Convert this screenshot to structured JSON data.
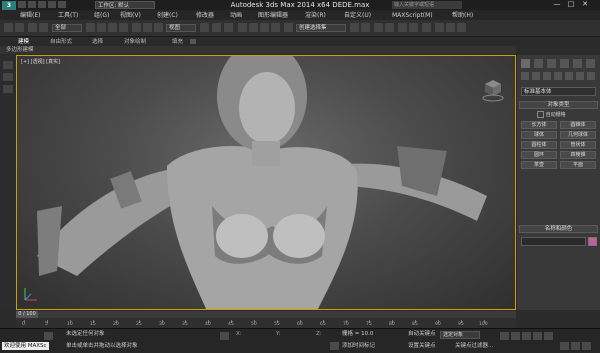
{
  "titlebar": {
    "logo": "3",
    "workspace": "工作区: 默认",
    "title": "Autodesk 3ds Max  2014 x64      DEDE.max",
    "search_placeholder": "输入关键字或短语",
    "window_buttons": [
      "—",
      "□",
      "✕"
    ]
  },
  "menu": [
    "编辑(E)",
    "工具(T)",
    "组(G)",
    "视图(V)",
    "创建(C)",
    "修改器",
    "动画",
    "图形编辑器",
    "渲染(R)",
    "自定义(U)",
    "MAXScript(M)",
    "帮助(H)"
  ],
  "toolbar": {
    "selection_filter": "全部",
    "ref_coord": "视图",
    "named_selection": "创建选择集"
  },
  "ribbon": {
    "tabs": [
      "建模",
      "自由形式",
      "选择",
      "对象绘制",
      "填充"
    ],
    "subtab": "多边形建模"
  },
  "viewport": {
    "label": "[+] [透视] [真实]"
  },
  "command_panel": {
    "category": "标准基本体",
    "rollout_object_type": "对象类型",
    "autogrid": "自动栅格",
    "object_buttons": [
      "长方体",
      "圆锥体",
      "球体",
      "几何球体",
      "圆柱体",
      "管状体",
      "圆环",
      "四棱锥",
      "茶壶",
      "平面"
    ],
    "rollout_name_color": "名称和颜色",
    "swatch_color": "#c060a0"
  },
  "timeline": {
    "current": "0 / 100",
    "ticks": [
      "0",
      "5",
      "10",
      "15",
      "20",
      "25",
      "30",
      "35",
      "40",
      "45",
      "50",
      "55",
      "60",
      "65",
      "70",
      "75",
      "80",
      "85",
      "90",
      "95",
      "100"
    ]
  },
  "status": {
    "maxscript_label": "欢迎使用 MAXSc",
    "prompt_1": "未选定任何对象",
    "prompt_2": "单击或单击并拖动以选择对象",
    "grid": "栅格 = 10.0",
    "add_time_tag": "添加时间标记",
    "auto_key": "自动关键点",
    "selected_object": "选定对象",
    "set_key": "设置关键点",
    "key_filters": "关键点过滤器..."
  }
}
